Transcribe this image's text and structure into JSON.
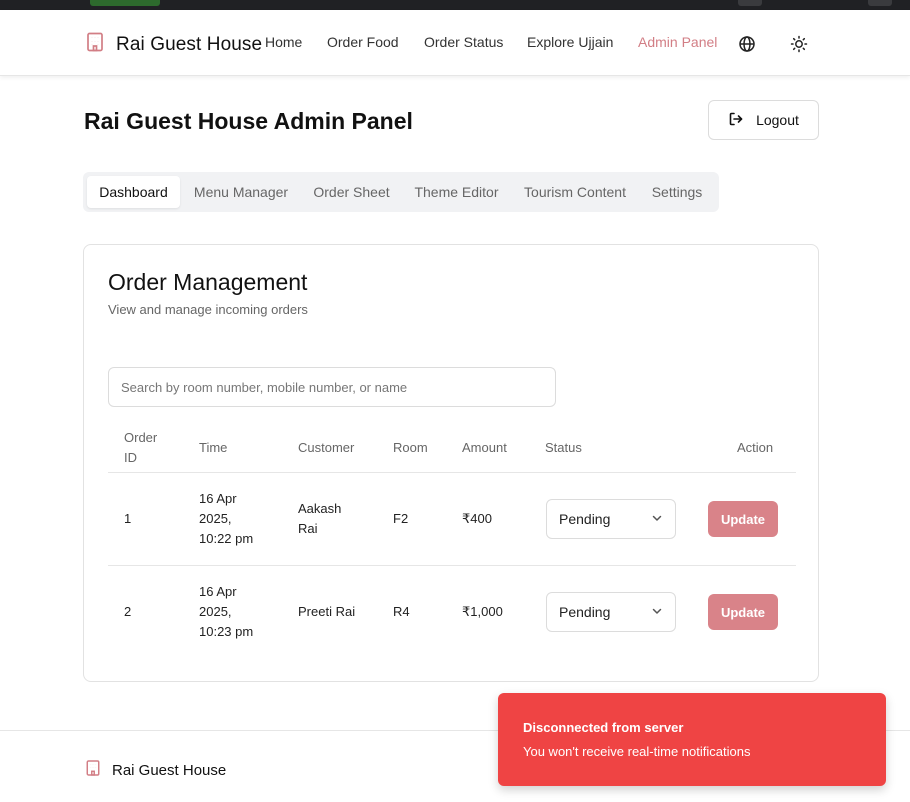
{
  "colors": {
    "accent": "#d27e85",
    "update_button": "#d98389",
    "toast_bg": "#ef4444",
    "browser_bar": "#202124"
  },
  "header": {
    "brand": "Rai Guest House",
    "brand_icon": "building-icon",
    "nav": [
      {
        "label": "Home"
      },
      {
        "label": "Order Food"
      },
      {
        "label": "Order Status"
      },
      {
        "label": "Explore Ujjain"
      },
      {
        "label": "Admin Panel",
        "active": true
      }
    ],
    "language_icon": "globe-icon",
    "theme_icon": "sun-icon"
  },
  "page": {
    "title": "Rai Guest House Admin Panel",
    "logout_label": "Logout",
    "logout_icon": "logout-icon"
  },
  "tabs": [
    {
      "label": "Dashboard",
      "active": true
    },
    {
      "label": "Menu Manager"
    },
    {
      "label": "Order Sheet"
    },
    {
      "label": "Theme Editor"
    },
    {
      "label": "Tourism Content"
    },
    {
      "label": "Settings"
    }
  ],
  "orders": {
    "title": "Order Management",
    "subtitle": "View and manage incoming orders",
    "search_placeholder": "Search by room number, mobile number, or name",
    "columns": {
      "order_id": [
        "Order",
        "ID"
      ],
      "time": "Time",
      "customer": "Customer",
      "room": "Room",
      "amount": "Amount",
      "status": "Status",
      "action": "Action"
    },
    "rows": [
      {
        "id": "1",
        "time": [
          "16 Apr",
          "2025,",
          "10:22 pm"
        ],
        "customer": [
          "Aakash",
          "Rai"
        ],
        "room": "F2",
        "amount": "₹400",
        "status": "Pending",
        "action": "Update"
      },
      {
        "id": "2",
        "time": [
          "16 Apr",
          "2025,",
          "10:23 pm"
        ],
        "customer": [
          "Preeti Rai"
        ],
        "room": "R4",
        "amount": "₹1,000",
        "status": "Pending",
        "action": "Update"
      }
    ]
  },
  "footer": {
    "brand": "Rai Guest House"
  },
  "toast": {
    "title": "Disconnected from server",
    "message": "You won't receive real-time notifications"
  }
}
